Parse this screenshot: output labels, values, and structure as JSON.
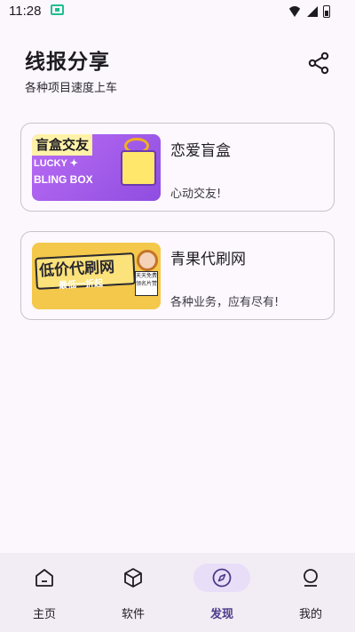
{
  "status_bar": {
    "time": "11:28"
  },
  "header": {
    "title": "线报分享",
    "subtitle": "各种项目速度上车"
  },
  "cards": [
    {
      "title": "恋爱盲盒",
      "desc": "心动交友!",
      "thumb_title": "盲盒交友",
      "thumb_line1": "LUCKY ✦",
      "thumb_line2": "BLING BOX"
    },
    {
      "title": "青果代刷网",
      "desc": "各种业务，应有尽有!",
      "thumb_title": "低价代刷网",
      "thumb_sub": "最低一折起",
      "thumb_sign": "天天免费领名片赞"
    }
  ],
  "nav": [
    {
      "label": "主页",
      "icon": "home-icon"
    },
    {
      "label": "软件",
      "icon": "cube-icon"
    },
    {
      "label": "发现",
      "icon": "compass-icon",
      "active": true
    },
    {
      "label": "我的",
      "icon": "person-icon"
    }
  ],
  "colors": {
    "background": "#fcf6fd",
    "nav_active_pill": "#e8def8",
    "accent": "#4a3b8a"
  }
}
